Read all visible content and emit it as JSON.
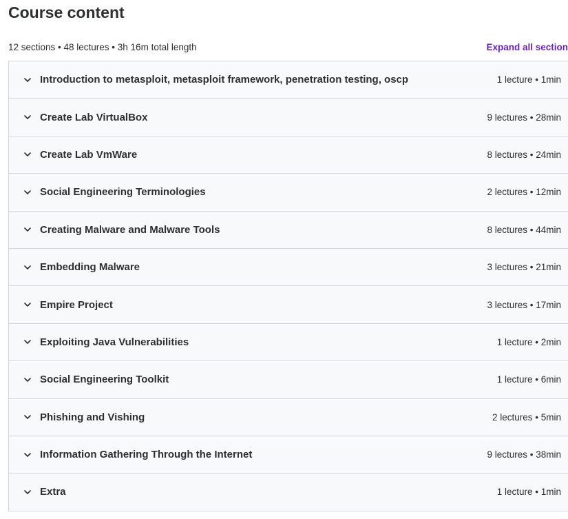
{
  "header": {
    "title": "Course content",
    "summary": "12 sections • 48 lectures • 3h 16m total length",
    "expand_all_label": "Expand all section"
  },
  "colors": {
    "accent": "#6a1fd0",
    "section_background": "#f7f9fa",
    "border": "#d1d7dc",
    "text": "#2d2f31"
  },
  "icons": {
    "section_toggle": "chevron-down-icon"
  },
  "sections": [
    {
      "title": "Introduction to metasploit, metasploit framework, penetration testing, oscp",
      "meta": "1 lecture • 1min"
    },
    {
      "title": "Create Lab VirtualBox",
      "meta": "9 lectures • 28min"
    },
    {
      "title": "Create Lab VmWare",
      "meta": "8 lectures • 24min"
    },
    {
      "title": "Social Engineering Terminologies",
      "meta": "2 lectures • 12min"
    },
    {
      "title": "Creating Malware and Malware Tools",
      "meta": "8 lectures • 44min"
    },
    {
      "title": "Embedding Malware",
      "meta": "3 lectures • 21min"
    },
    {
      "title": "Empire Project",
      "meta": "3 lectures • 17min"
    },
    {
      "title": "Exploiting Java Vulnerabilities",
      "meta": "1 lecture • 2min"
    },
    {
      "title": "Social Engineering Toolkit",
      "meta": "1 lecture • 6min"
    },
    {
      "title": "Phishing and Vishing",
      "meta": "2 lectures • 5min"
    },
    {
      "title": "Information Gathering Through the Internet",
      "meta": "9 lectures • 38min"
    },
    {
      "title": "Extra",
      "meta": "1 lecture • 1min"
    }
  ]
}
